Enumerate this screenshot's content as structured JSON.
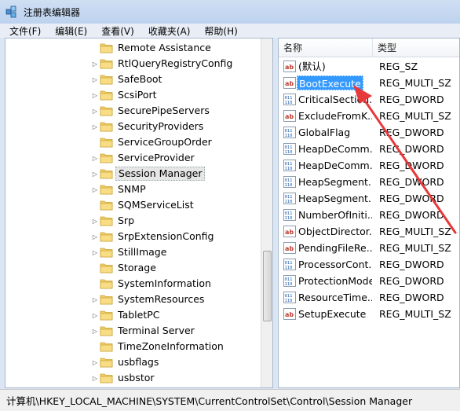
{
  "window": {
    "title": "注册表编辑器"
  },
  "menu": [
    {
      "label": "文件(F)"
    },
    {
      "label": "编辑(E)"
    },
    {
      "label": "查看(V)"
    },
    {
      "label": "收藏夹(A)"
    },
    {
      "label": "帮助(H)"
    }
  ],
  "tree": {
    "items": [
      {
        "label": "Remote Assistance",
        "has_children": false
      },
      {
        "label": "RtlQueryRegistryConfig",
        "has_children": true
      },
      {
        "label": "SafeBoot",
        "has_children": true
      },
      {
        "label": "ScsiPort",
        "has_children": true
      },
      {
        "label": "SecurePipeServers",
        "has_children": true
      },
      {
        "label": "SecurityProviders",
        "has_children": true
      },
      {
        "label": "ServiceGroupOrder",
        "has_children": false
      },
      {
        "label": "ServiceProvider",
        "has_children": true
      },
      {
        "label": "Session Manager",
        "has_children": true,
        "selected": true
      },
      {
        "label": "SNMP",
        "has_children": true
      },
      {
        "label": "SQMServiceList",
        "has_children": false
      },
      {
        "label": "Srp",
        "has_children": true
      },
      {
        "label": "SrpExtensionConfig",
        "has_children": true
      },
      {
        "label": "StillImage",
        "has_children": true
      },
      {
        "label": "Storage",
        "has_children": false
      },
      {
        "label": "SystemInformation",
        "has_children": false
      },
      {
        "label": "SystemResources",
        "has_children": true
      },
      {
        "label": "TabletPC",
        "has_children": true
      },
      {
        "label": "Terminal Server",
        "has_children": true
      },
      {
        "label": "TimeZoneInformation",
        "has_children": false
      },
      {
        "label": "usbflags",
        "has_children": true
      },
      {
        "label": "usbstor",
        "has_children": true
      }
    ]
  },
  "values": {
    "headers": {
      "name": "名称",
      "type": "类型"
    },
    "rows": [
      {
        "name": "(默认)",
        "type": "REG_SZ",
        "icon": "string-value-icon"
      },
      {
        "name": "BootExecute",
        "type": "REG_MULTI_SZ",
        "icon": "string-value-icon",
        "selected": true
      },
      {
        "name": "CriticalSectionTimeout",
        "display": "CriticalSection...",
        "type": "REG_DWORD",
        "icon": "binary-value-icon"
      },
      {
        "name": "ExcludeFromKnownDlls",
        "display": "ExcludeFromK...",
        "type": "REG_MULTI_SZ",
        "icon": "string-value-icon"
      },
      {
        "name": "GlobalFlag",
        "type": "REG_DWORD",
        "icon": "binary-value-icon"
      },
      {
        "name": "HeapDeCommitFreeBlockThreshold",
        "display": "HeapDeComm...",
        "type": "REG_DWORD",
        "icon": "binary-value-icon"
      },
      {
        "name": "HeapDeCommitTotalFreeThreshold",
        "display": "HeapDeComm...",
        "type": "REG_DWORD",
        "icon": "binary-value-icon"
      },
      {
        "name": "HeapSegmentCommit",
        "display": "HeapSegment...",
        "type": "REG_DWORD",
        "icon": "binary-value-icon"
      },
      {
        "name": "HeapSegmentReserve",
        "display": "HeapSegment...",
        "type": "REG_DWORD",
        "icon": "binary-value-icon"
      },
      {
        "name": "NumberOfInitialSessions",
        "display": "NumberOfIniti...",
        "type": "REG_DWORD",
        "icon": "binary-value-icon"
      },
      {
        "name": "ObjectDirectories",
        "display": "ObjectDirector...",
        "type": "REG_MULTI_SZ",
        "icon": "string-value-icon"
      },
      {
        "name": "PendingFileRenameOperations",
        "display": "PendingFileRe...",
        "type": "REG_MULTI_SZ",
        "icon": "string-value-icon"
      },
      {
        "name": "ProcessorControl",
        "display": "ProcessorCont...",
        "type": "REG_DWORD",
        "icon": "binary-value-icon"
      },
      {
        "name": "ProtectionMode",
        "type": "REG_DWORD",
        "icon": "binary-value-icon"
      },
      {
        "name": "ResourceTimeoutCount",
        "display": "ResourceTime...",
        "type": "REG_DWORD",
        "icon": "binary-value-icon"
      },
      {
        "name": "SetupExecute",
        "type": "REG_MULTI_SZ",
        "icon": "string-value-icon"
      }
    ]
  },
  "statusbar": {
    "path": "计算机\\HKEY_LOCAL_MACHINE\\SYSTEM\\CurrentControlSet\\Control\\Session Manager"
  },
  "annotation": {
    "color": "#e8393a",
    "points_to": "BootExecute"
  },
  "colors": {
    "selection": "#3399ff",
    "folder": "#f3cf63",
    "window_frame": "#bcd2ee"
  }
}
